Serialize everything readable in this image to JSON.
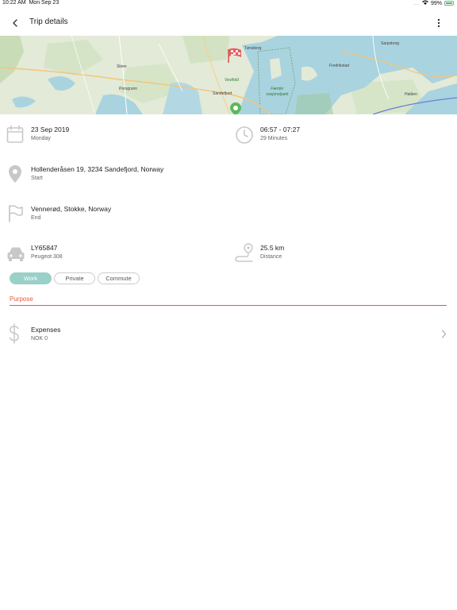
{
  "status": {
    "time": "10:22 AM",
    "date": "Mon Sep 23",
    "signal": "....",
    "battery": "99%"
  },
  "app_bar": {
    "title": "Trip details",
    "back_icon": "chevron-left-icon",
    "more_icon": "more-vertical-icon"
  },
  "map": {
    "places": [
      "Skien",
      "Porsgrunn",
      "Tønsberg",
      "Vestfold",
      "Sandefjord",
      "Færder nasjonalpark",
      "Fredrikstad",
      "Sarpsborg",
      "Halden"
    ]
  },
  "trip": {
    "date": "23 Sep 2019",
    "weekday": "Monday",
    "time_range": "06:57 - 07:27",
    "duration": "29 Minutes",
    "start_address": "Hollenderåsen 19, 3234 Sandefjord, Norway",
    "start_label": "Start",
    "end_address": "Vennerød, Stokke, Norway",
    "end_label": "End",
    "plate": "LY65847",
    "car_model": "Peugeot 308",
    "distance": "25.5 km",
    "distance_label": "Distance"
  },
  "categories": [
    {
      "label": "Work",
      "selected": true
    },
    {
      "label": "Private",
      "selected": false
    },
    {
      "label": "Commute",
      "selected": false
    }
  ],
  "purpose": {
    "label": "Purpose"
  },
  "expenses": {
    "title": "Expenses",
    "amount": "NOK 0"
  },
  "colors": {
    "accent": "#e8593d",
    "chip_selected": "#9ad0c7",
    "icon_gray": "#c8c8c8"
  }
}
